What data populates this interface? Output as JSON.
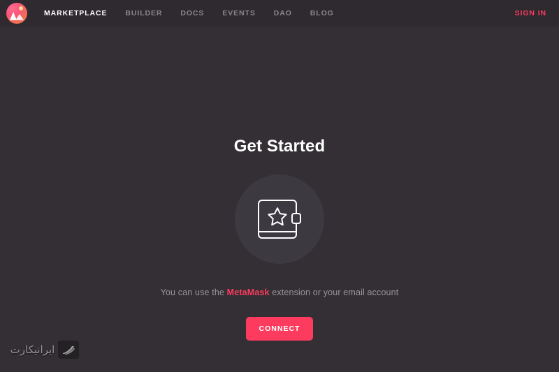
{
  "navbar": {
    "logo_icon": "decentraland-logo-icon",
    "items": [
      {
        "label": "MARKETPLACE",
        "active": true
      },
      {
        "label": "BUILDER",
        "active": false
      },
      {
        "label": "DOCS",
        "active": false
      },
      {
        "label": "EVENTS",
        "active": false
      },
      {
        "label": "DAO",
        "active": false
      },
      {
        "label": "BLOG",
        "active": false
      }
    ],
    "sign_in_label": "SIGN IN",
    "background_color": "#2E2A2F",
    "active_color": "#FFFFFF",
    "inactive_color": "#8C868C",
    "accent_color": "#FB3B5F"
  },
  "main": {
    "title": "Get Started",
    "wallet_icon": "wallet-star-icon",
    "subtitle": {
      "before": "You can use the ",
      "highlight": "MetaMask",
      "after": " extension or your email account"
    },
    "connect_label": "CONNECT",
    "background_color": "#332F34",
    "circle_color": "#3C3940",
    "button_color": "#FC3B5F"
  },
  "watermark": {
    "text": "ایرانیکارت",
    "mark_icon": "iranicard-logo-icon"
  }
}
